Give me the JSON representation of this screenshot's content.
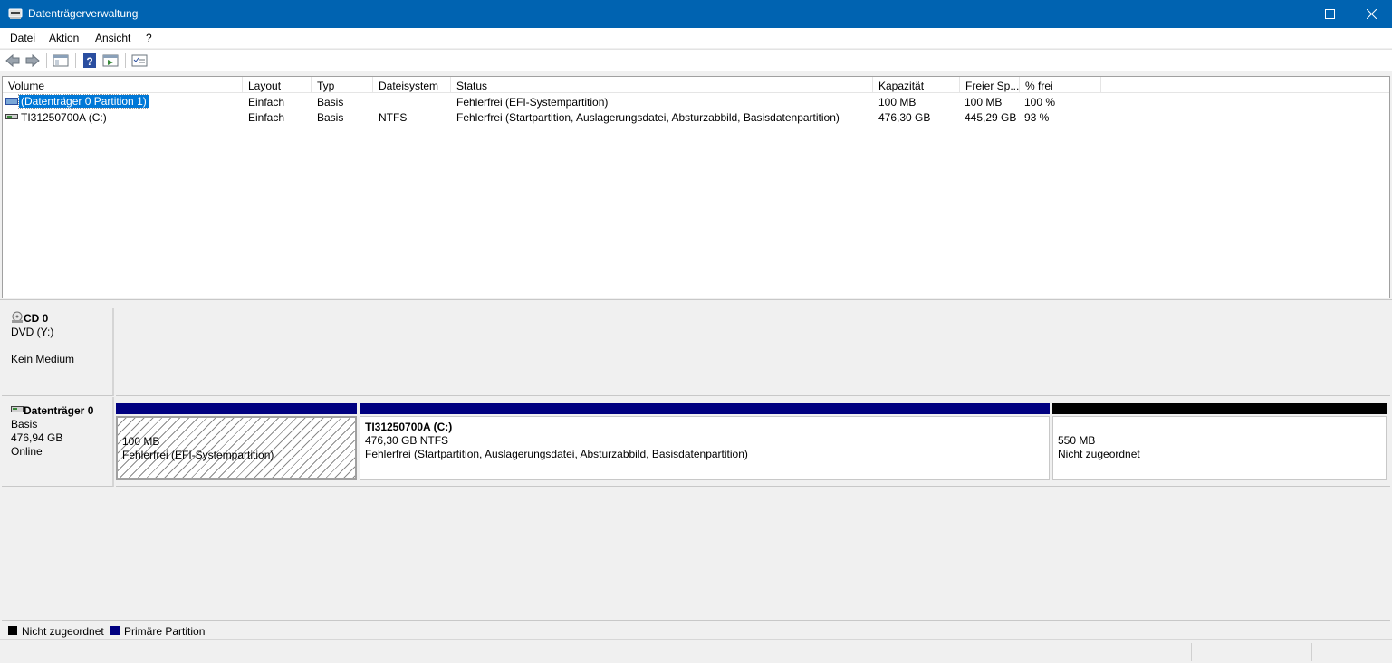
{
  "window": {
    "title": "Datenträgerverwaltung"
  },
  "menu": [
    "Datei",
    "Aktion",
    "Ansicht",
    "?"
  ],
  "toolbar": {
    "icons": [
      "back-icon",
      "forward-icon",
      "show-hide-console-tree-icon",
      "help-icon",
      "show-hide-action-pane-icon",
      "properties-icon"
    ]
  },
  "columns": [
    "Volume",
    "Layout",
    "Typ",
    "Dateisystem",
    "Status",
    "Kapazität",
    "Freier Sp...",
    "% frei"
  ],
  "volumes": [
    {
      "volume": "(Datenträger 0 Partition 1)",
      "layout": "Einfach",
      "typ": "Basis",
      "dateisystem": "",
      "status": "Fehlerfrei (EFI-Systempartition)",
      "kapazitaet": "100 MB",
      "frei": "100 MB",
      "prozent": "100 %"
    },
    {
      "volume": "TI31250700A (C:)",
      "layout": "Einfach",
      "typ": "Basis",
      "dateisystem": "NTFS",
      "status": "Fehlerfrei (Startpartition, Auslagerungsdatei, Absturzabbild, Basisdatenpartition)",
      "kapazitaet": "476,30 GB",
      "frei": "445,29 GB",
      "prozent": "93 %"
    }
  ],
  "cd": {
    "name": "CD 0",
    "drive": "DVD (Y:)",
    "medium": "Kein Medium"
  },
  "disk0": {
    "name": "Datenträger 0",
    "type": "Basis",
    "size": "476,94 GB",
    "state": "Online",
    "partitions": [
      {
        "title": "",
        "size": "100 MB",
        "status": "Fehlerfrei (EFI-Systempartition)"
      },
      {
        "title": "TI31250700A  (C:)",
        "size": "476,30 GB NTFS",
        "status": "Fehlerfrei (Startpartition, Auslagerungsdatei, Absturzabbild, Basisdatenpartition)"
      },
      {
        "title": "",
        "size": "550 MB",
        "status": "Nicht zugeordnet"
      }
    ]
  },
  "legend": [
    "Nicht zugeordnet",
    "Primäre Partition"
  ],
  "colors": {
    "titlebar": "#0063b1",
    "primary": "#000080",
    "unallocated": "#000000",
    "selection": "#0078d7"
  }
}
